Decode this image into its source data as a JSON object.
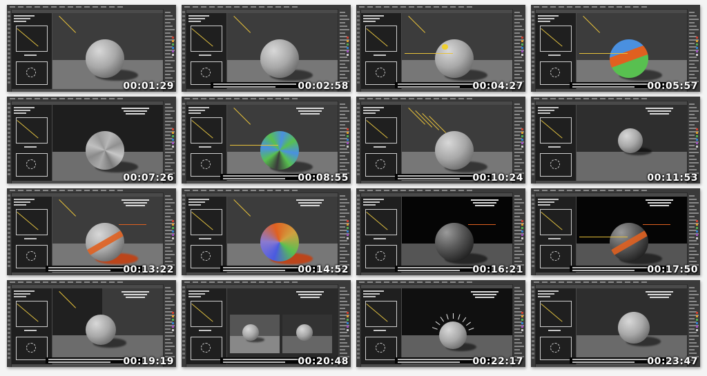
{
  "contact_sheet": {
    "columns": 4,
    "rows": 4,
    "thumbnails": [
      {
        "timestamp": "00:01:29",
        "variant": "plain-dark"
      },
      {
        "timestamp": "00:02:58",
        "variant": "plain-caption"
      },
      {
        "timestamp": "00:04:27",
        "variant": "highlight"
      },
      {
        "timestamp": "00:05:57",
        "variant": "color-bands"
      },
      {
        "timestamp": "00:07:26",
        "variant": "faceted"
      },
      {
        "timestamp": "00:08:55",
        "variant": "faceted-color"
      },
      {
        "timestamp": "00:10:24",
        "variant": "light-rays"
      },
      {
        "timestamp": "00:11:53",
        "variant": "small-sphere"
      },
      {
        "timestamp": "00:13:22",
        "variant": "orange-band"
      },
      {
        "timestamp": "00:14:52",
        "variant": "multi-color"
      },
      {
        "timestamp": "00:16:21",
        "variant": "dark-bg"
      },
      {
        "timestamp": "00:17:50",
        "variant": "dark-bg-lines"
      },
      {
        "timestamp": "00:19:19",
        "variant": "split-bg"
      },
      {
        "timestamp": "00:20:48",
        "variant": "two-spheres"
      },
      {
        "timestamp": "00:22:17",
        "variant": "glow-rays"
      },
      {
        "timestamp": "00:23:47",
        "variant": "plain-blue-note"
      }
    ]
  },
  "colors": {
    "page_background": "#f4f4f4",
    "ui_gray": "#4a4a4a",
    "highlight_yellow": "#e8c23a",
    "accent_orange": "#e06020",
    "accent_blue": "#4a90e0",
    "accent_green": "#58c050"
  }
}
